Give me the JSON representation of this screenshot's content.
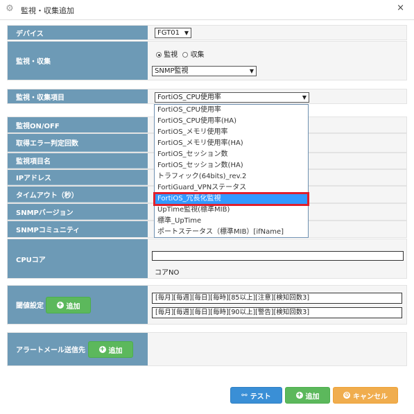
{
  "window": {
    "title": "監視・収集追加",
    "close_glyph": "×"
  },
  "device": {
    "label": "デバイス",
    "value": "FGT01"
  },
  "monitor_collect": {
    "label": "監視・収集",
    "radio_monitor": "監視",
    "radio_collect": "収集",
    "selected": "monitor",
    "type_value": "SNMP監視"
  },
  "item": {
    "label": "監視・収集項目",
    "value": "FortiOS_CPU使用率",
    "options": [
      "FortiOS_CPU使用率",
      "FortiOS_CPU使用率(HA)",
      "FortiOS_メモリ使用率",
      "FortiOS_メモリ使用率(HA)",
      "FortiOS_セッション数",
      "FortiOS_セッション数(HA)",
      "トラフィック(64bits)_rev.2",
      "FortiGuard_VPNステータス",
      "FortiOS_冗長化監視",
      "UpTime監視(標準MIB)",
      "標準_UpTime",
      "ポートステータス（標準MIB）[ifName]"
    ],
    "highlighted_index": 8
  },
  "fields": {
    "onoff": "監視ON/OFF",
    "error_count": "取得エラー判定回数",
    "item_name": "監視項目名",
    "ip": "IPアドレス",
    "timeout": "タイムアウト（秒）",
    "snmp_version": "SNMPバージョン",
    "snmp_community": "SNMPコミュニティ"
  },
  "cpu_core": {
    "label": "CPUコア",
    "input_value": "",
    "note": "コアNO"
  },
  "threshold": {
    "label": "閾値設定",
    "add_label": "追加",
    "rules": [
      "[毎月][毎週][毎日][毎時][85以上][注意][検知回数3]",
      "[毎月][毎週][毎日][毎時][90以上][警告][検知回数3]"
    ]
  },
  "alert_mail": {
    "label": "アラートメール送信先",
    "add_label": "追加"
  },
  "footer": {
    "test": "テスト",
    "add": "追加",
    "cancel": "キャンセル"
  },
  "colors": {
    "label_bg": "#6d9ab6",
    "highlight": "#3399ff",
    "red_frame": "#e0202c"
  }
}
